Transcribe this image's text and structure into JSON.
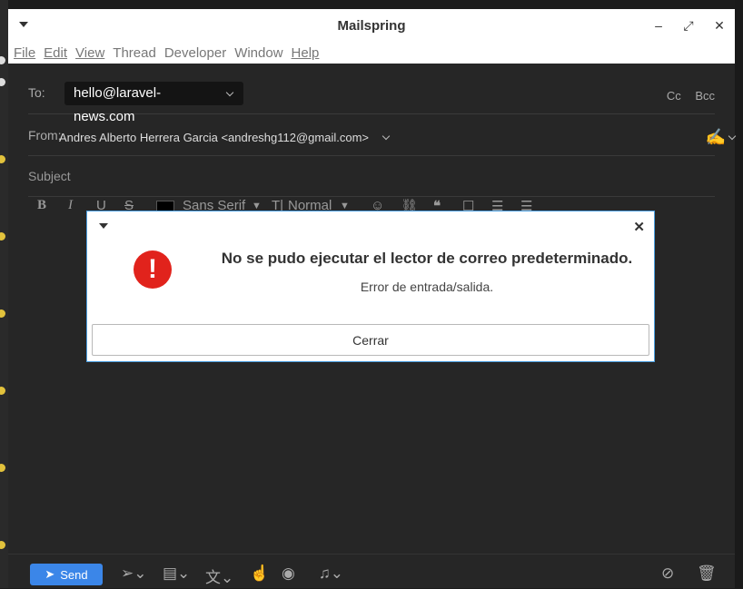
{
  "window": {
    "title": "Mailspring",
    "controls": {
      "minimize": "–",
      "maximize": "⤢",
      "close": "✕"
    }
  },
  "menu": [
    "File",
    "Edit",
    "View",
    "Thread",
    "Developer",
    "Window",
    "Help"
  ],
  "composer": {
    "to_label": "To:",
    "to_recipient": "hello@laravel-news.com",
    "cc_label": "Cc",
    "bcc_label": "Bcc",
    "from_label": "From:",
    "from_value": "Andres Alberto Herrera Garcia <andreshg112@gmail.com>",
    "subject_placeholder": "Subject"
  },
  "toolbar": {
    "bold": "B",
    "italic": "I",
    "underline": "U",
    "strike": "S",
    "font": "Sans Serif",
    "size_icon": "T|",
    "size": "Normal"
  },
  "bottom": {
    "send_label": "Send"
  },
  "dialog": {
    "title": "No se pudo ejecutar el lector de correo predeterminado.",
    "message": "Error de entrada/salida.",
    "button": "Cerrar",
    "error_glyph": "!"
  },
  "colors": {
    "accent": "#3b86e8",
    "error": "#e1231c",
    "dialog_border": "#4a9ee0"
  }
}
